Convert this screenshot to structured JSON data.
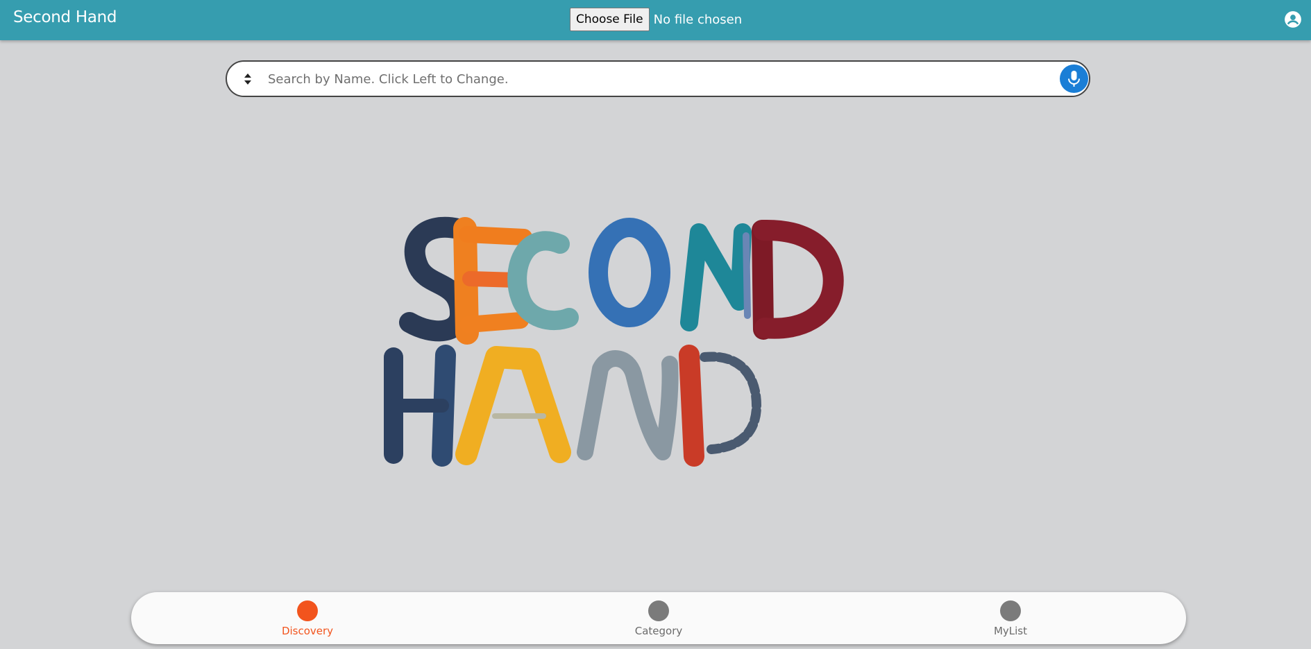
{
  "app": {
    "title": "Second Hand"
  },
  "header": {
    "file_button_label": "Choose File",
    "file_status": "No file chosen",
    "account_icon": "account-circle-icon"
  },
  "search": {
    "placeholder": "Search by Name. Click Left to Change.",
    "value": "",
    "mode_icon": "sort-updown-icon",
    "mic_icon": "microphone-icon"
  },
  "hero": {
    "logo_line1": "SECOND",
    "logo_line2": "HAND"
  },
  "bottom_nav": {
    "items": [
      {
        "label": "Discovery",
        "active": true
      },
      {
        "label": "Category",
        "active": false
      },
      {
        "label": "MyList",
        "active": false
      }
    ]
  },
  "colors": {
    "header": "#369daf",
    "background": "#d3d4d6",
    "accent_active": "#f2541d",
    "mic": "#1a7ed6",
    "inactive": "#7b7b7b"
  }
}
